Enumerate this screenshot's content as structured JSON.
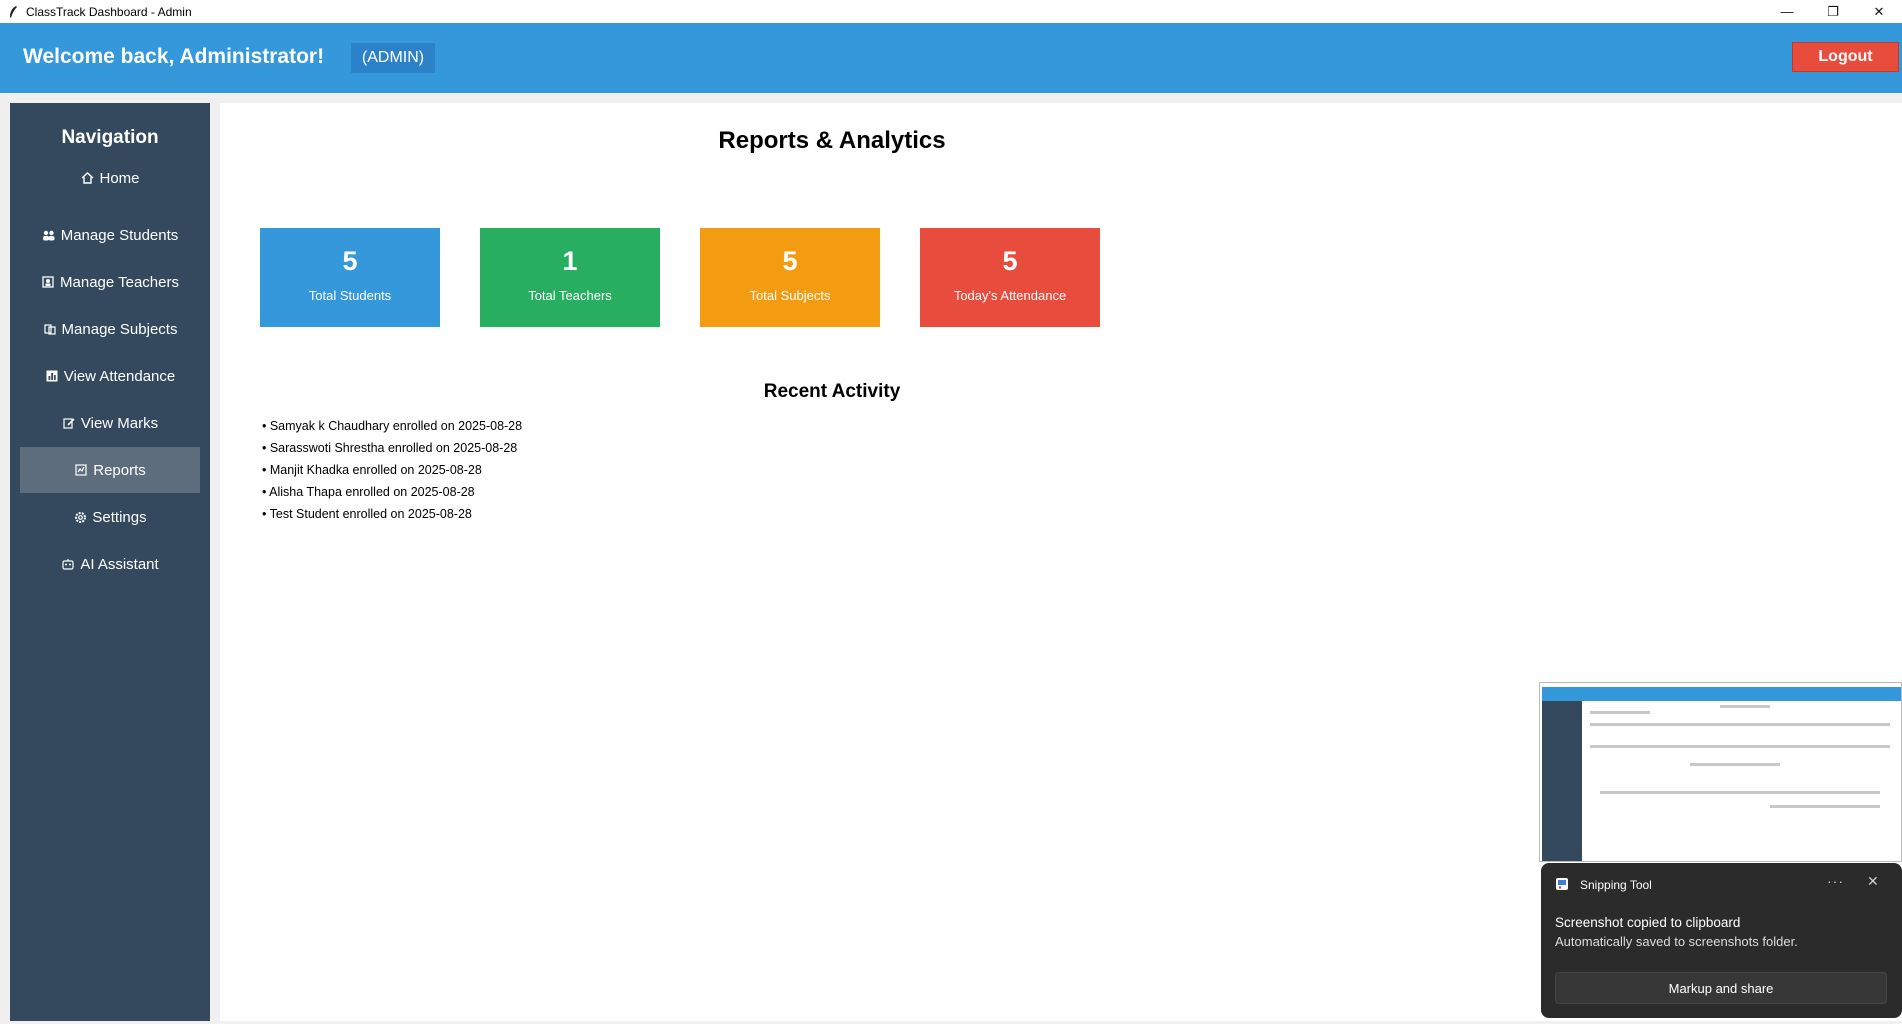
{
  "window": {
    "title": "ClassTrack Dashboard - Admin",
    "controls": {
      "minimize": "—",
      "restore": "❐",
      "close": "✕"
    }
  },
  "header": {
    "welcome": "Welcome back, Administrator!",
    "role": "(ADMIN)",
    "logout": "Logout",
    "bg_color": "#3498db",
    "logout_color": "#e74c3c"
  },
  "sidebar": {
    "title": "Navigation",
    "bg_color": "#34495e",
    "items": [
      {
        "label": "Home",
        "icon": "home-icon"
      },
      {
        "label": "Manage Students",
        "icon": "users-icon"
      },
      {
        "label": "Manage Teachers",
        "icon": "teacher-icon"
      },
      {
        "label": "Manage Subjects",
        "icon": "books-icon"
      },
      {
        "label": "View Attendance",
        "icon": "chart-icon"
      },
      {
        "label": "View Marks",
        "icon": "edit-icon"
      },
      {
        "label": "Reports",
        "icon": "report-icon",
        "active": true
      },
      {
        "label": "Settings",
        "icon": "gear-icon"
      },
      {
        "label": "AI Assistant",
        "icon": "robot-icon"
      }
    ]
  },
  "main": {
    "title": "Reports & Analytics",
    "stats": [
      {
        "value": "5",
        "label": "Total Students",
        "color": "#3498db"
      },
      {
        "value": "1",
        "label": "Total Teachers",
        "color": "#27ae60"
      },
      {
        "value": "5",
        "label": "Total Subjects",
        "color": "#f39c12"
      },
      {
        "value": "5",
        "label": "Today's Attendance",
        "color": "#e74c3c"
      }
    ],
    "recent_title": "Recent Activity",
    "activities": [
      "• Samyak k Chaudhary enrolled on 2025-08-28",
      "• Sarasswoti Shrestha enrolled on 2025-08-28",
      "• Manjit Khadka enrolled on 2025-08-28",
      "• Alisha Thapa enrolled on 2025-08-28",
      "• Test Student enrolled on 2025-08-28"
    ]
  },
  "toast": {
    "app": "Snipping Tool",
    "more": "···",
    "close": "✕",
    "heading": "Screenshot copied to clipboard",
    "body": "Automatically saved to screenshots folder.",
    "button": "Markup and share"
  }
}
